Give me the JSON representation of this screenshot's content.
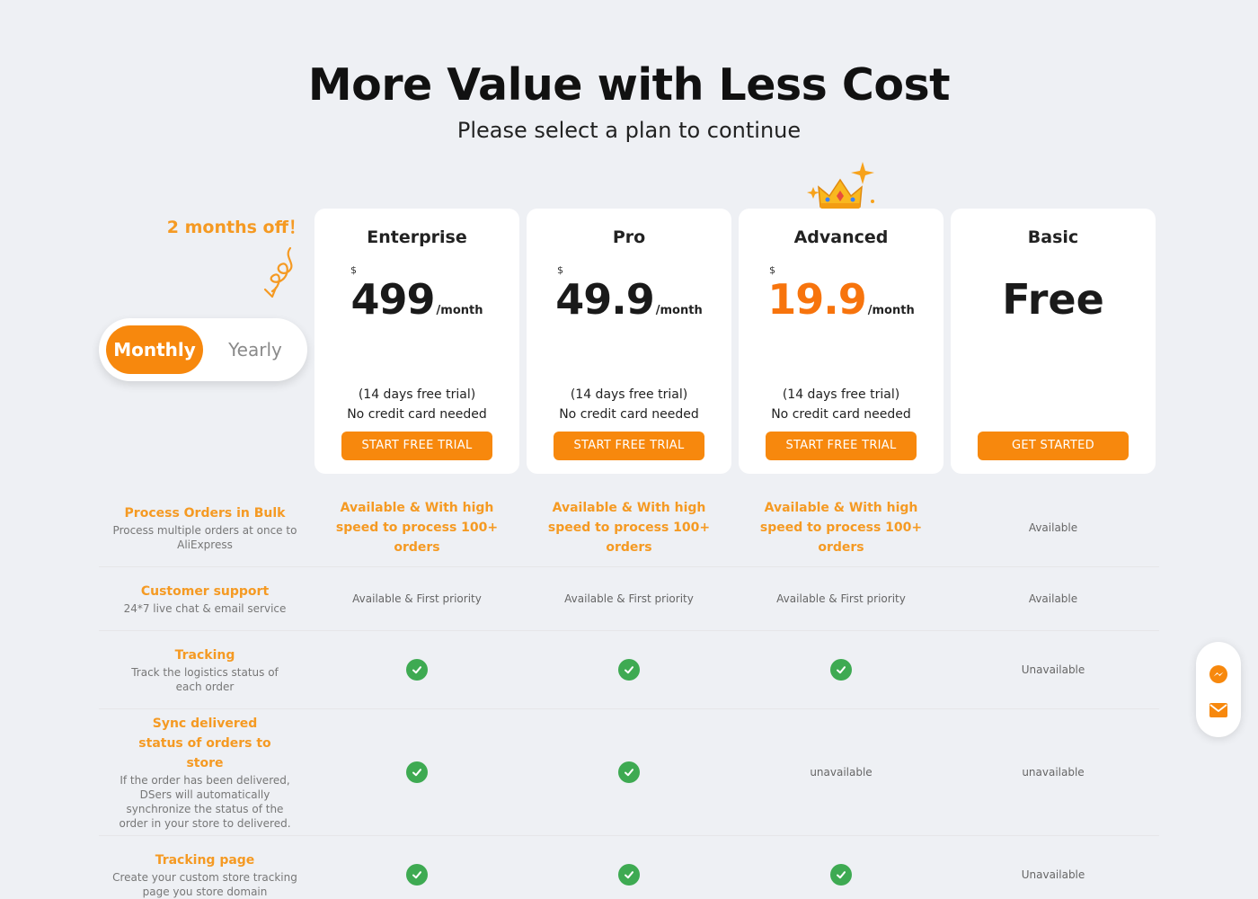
{
  "header": {
    "title": "More Value with Less Cost",
    "subtitle": "Please select a plan to continue"
  },
  "promo": {
    "text": "2 months off！"
  },
  "billing_toggle": {
    "options": [
      "Monthly",
      "Yearly"
    ],
    "selected": "Monthly"
  },
  "plans": [
    {
      "name": "Enterprise",
      "currency": "$",
      "price": "499",
      "unit": "/month",
      "trial": "(14 days free trial)",
      "note": "No credit card needed",
      "cta": "START FREE TRIAL"
    },
    {
      "name": "Pro",
      "currency": "$",
      "price": "49.9",
      "unit": "/month",
      "trial": "(14 days free trial)",
      "note": "No credit card needed",
      "cta": "START FREE TRIAL"
    },
    {
      "name": "Advanced",
      "currency": "$",
      "price": "19.9",
      "unit": "/month",
      "trial": "(14 days free trial)",
      "note": "No credit card needed",
      "cta": "START FREE TRIAL",
      "highlight_color": "#f7740d"
    },
    {
      "name": "Basic",
      "price": "Free",
      "cta": "GET STARTED"
    }
  ],
  "features": [
    {
      "title": "Process Orders in Bulk",
      "desc": "Process multiple orders at once to AliExpress",
      "values": [
        "Available & With high speed to process 100+ orders",
        "Available & With high speed to process 100+ orders",
        "Available & With high speed to process 100+ orders",
        "Available"
      ]
    },
    {
      "title": "Customer support",
      "desc": "24*7 live chat & email service",
      "values": [
        "Available & First priority",
        "Available & First priority",
        "Available & First priority",
        "Available"
      ]
    },
    {
      "title": "Tracking",
      "desc": "Track the logistics status of each order",
      "values": [
        "check",
        "check",
        "check",
        "Unavailable"
      ]
    },
    {
      "title": "Sync delivered status of orders to store",
      "desc": "If the order has been delivered, DSers will automatically synchronize the status of the order in your store to delivered.",
      "values": [
        "check",
        "check",
        "unavailable",
        "unavailable"
      ]
    },
    {
      "title": "Tracking page",
      "desc": "Create your custom store tracking page you store domain",
      "values": [
        "check",
        "check",
        "check",
        "Unavailable"
      ]
    }
  ],
  "colors": {
    "accent": "#f7880d",
    "feature_title": "#f59a23",
    "check": "#3eaa52",
    "background": "#eef0f4"
  },
  "icons": {
    "crown": "crown-icon",
    "check": "check-icon",
    "messenger": "messenger-icon",
    "mail": "mail-icon"
  }
}
